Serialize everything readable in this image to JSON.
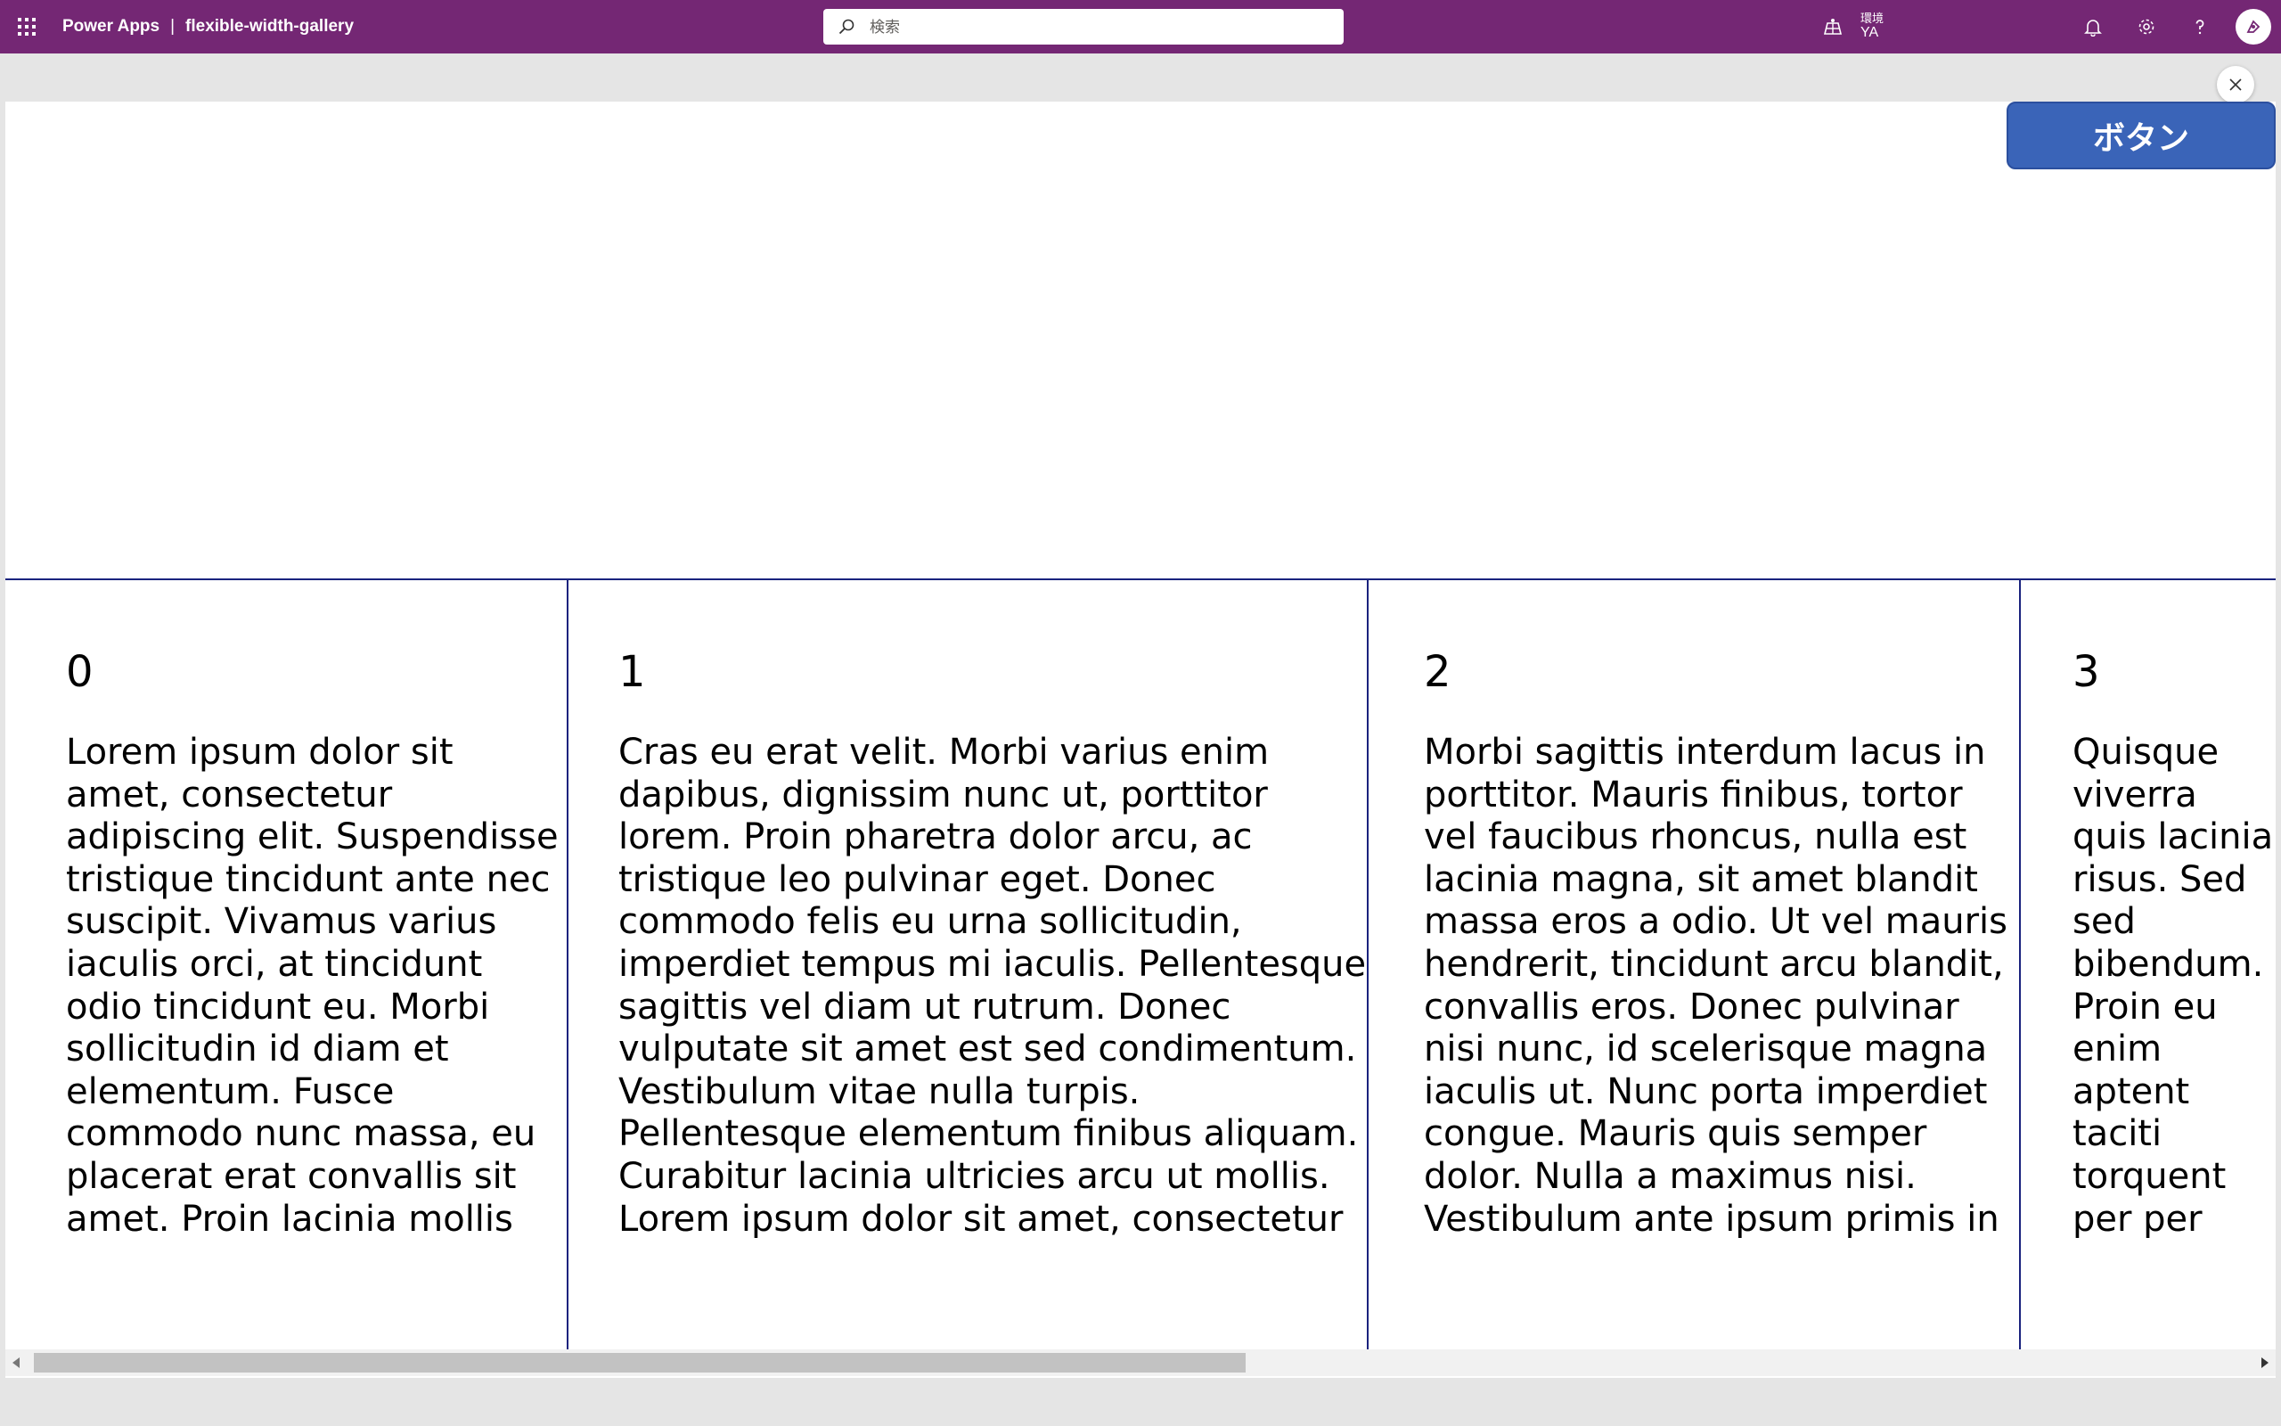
{
  "topbar": {
    "app_name": "Power Apps",
    "separator": "|",
    "app_file": "flexible-width-gallery",
    "search_placeholder": "検索",
    "environment_label": "環境",
    "environment_value": "YA",
    "colors": {
      "suite_bar": "#742774"
    }
  },
  "canvas": {
    "button_label": "ボタン",
    "button_color": "#3a64b8"
  },
  "gallery": {
    "border_color": "#1a237e",
    "items": [
      {
        "number": "0",
        "text": "Lorem ipsum dolor sit amet, consectetur adipiscing elit. Suspendisse tristique tincidunt ante nec suscipit. Vivamus varius iaculis orci, at tincidunt odio tincidunt eu. Morbi sollicitudin id diam et elementum. Fusce commodo nunc massa, eu placerat erat convallis sit amet. Proin lacinia mollis quam, eu sagittis mi sagittis eget. Quisque quis felis"
      },
      {
        "number": "1",
        "text": "Cras eu erat velit. Morbi varius enim dapibus, dignissim nunc ut, porttitor lorem. Proin pharetra dolor arcu, ac tristique leo pulvinar eget. Donec commodo felis eu urna sollicitudin, imperdiet tempus mi iaculis. Pellentesque sagittis vel diam ut rutrum. Donec vulputate sit amet est sed condimentum. Vestibulum vitae nulla turpis. Pellentesque elementum finibus aliquam. Curabitur lacinia ultricies arcu ut mollis. Lorem ipsum dolor sit amet, consectetur adipiscing elit. Donec ac accumsan elit, eget porta lectus. Etiam"
      },
      {
        "number": "2",
        "text": "Morbi sagittis interdum lacus in porttitor. Mauris finibus, tortor vel faucibus rhoncus, nulla est lacinia magna, sit amet blandit massa eros a odio. Ut vel mauris hendrerit, tincidunt arcu blandit, convallis eros. Donec pulvinar nisi nunc, id scelerisque magna iaculis ut. Nunc porta imperdiet congue. Mauris quis semper dolor. Nulla a maximus nisi. Vestibulum ante ipsum primis in faucibus orci luctus et ultrices posuere cubilia curae; Curabitur"
      },
      {
        "number": "3",
        "text": "Quisque viverra quis lacinia risus. Sed sed bibendum. Proin eu enim aptent taciti torquent per per inceptos accumsan nulla diam. Nam nec eros pellentesque ac nec neque hendrerit eleifend. Donec"
      }
    ]
  }
}
